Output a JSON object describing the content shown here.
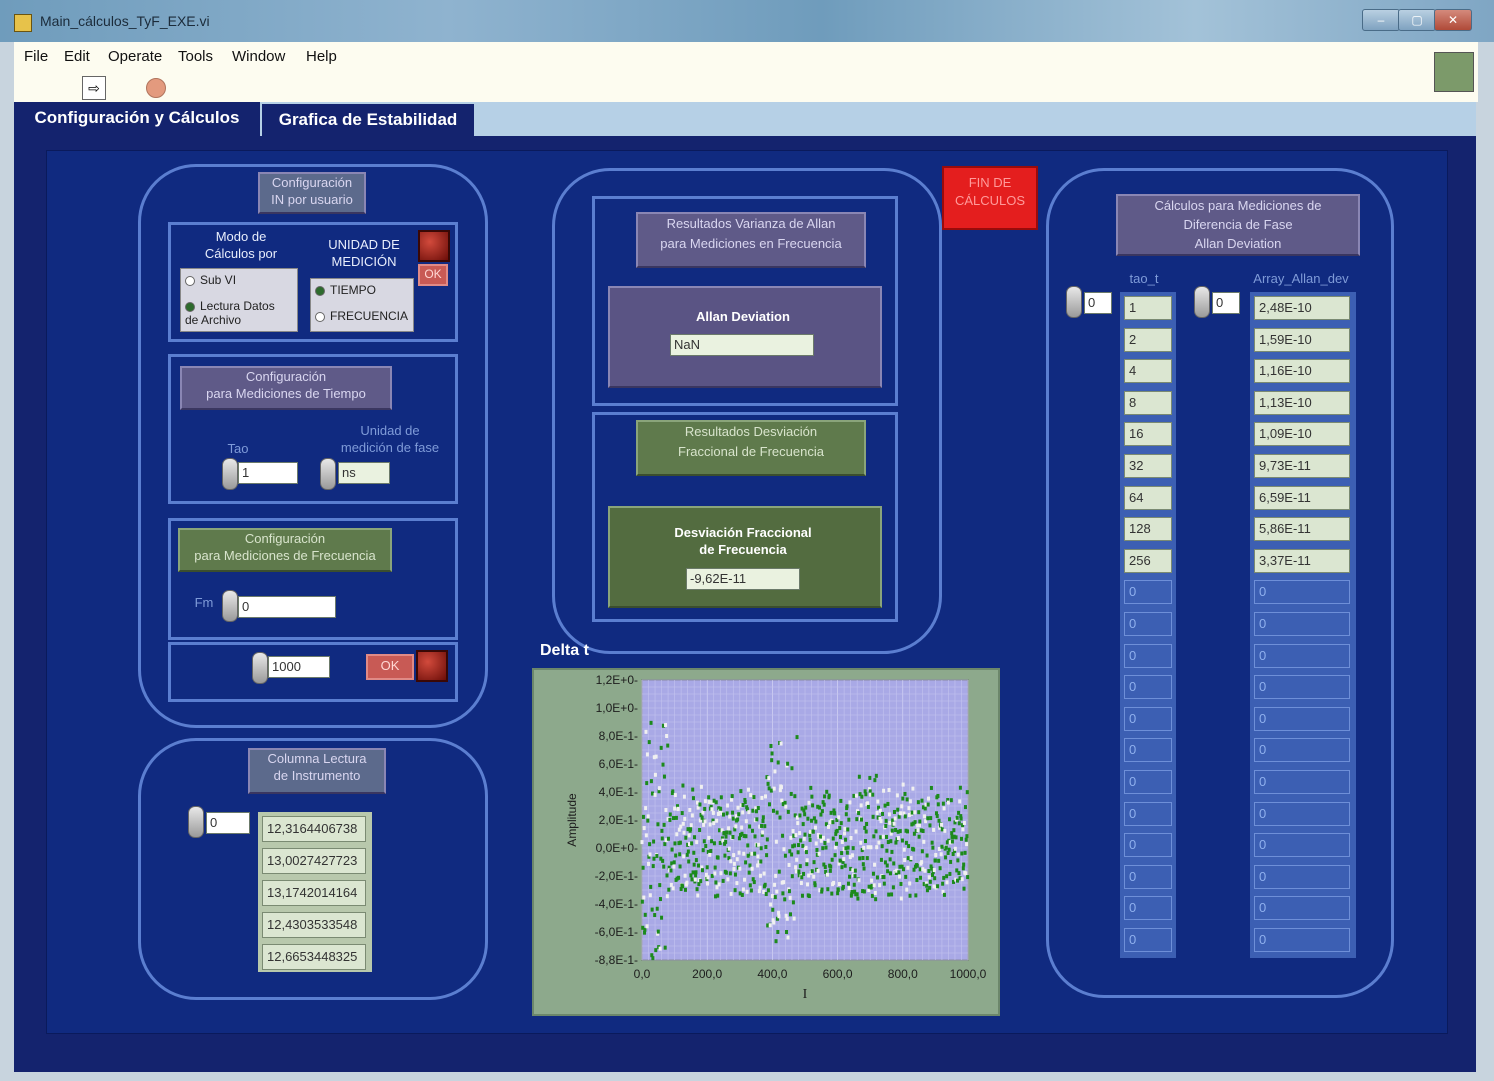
{
  "window": {
    "title": "Main_cálculos_TyF_EXE.vi",
    "min": "–",
    "max": "▢",
    "close": "✕"
  },
  "menu": [
    "File",
    "Edit",
    "Operate",
    "Tools",
    "Window",
    "Help"
  ],
  "tabs": [
    "Configuración y Cálculos",
    "Grafica de Estabilidad"
  ],
  "config": {
    "header": "Configuración\nIN por usuario",
    "modo_label": "Modo de\nCálculos por",
    "modo_options": [
      "Sub VI",
      "Lectura Datos\nde Archivo"
    ],
    "modo_selected": 1,
    "unidad_label": "UNIDAD DE\nMEDICIÓN",
    "unidad_options": [
      "TIEMPO",
      "FRECUENCIA"
    ],
    "unidad_selected": 0,
    "ok": "OK"
  },
  "tiempo": {
    "header": "Configuración\npara Mediciones de Tiempo",
    "tao_label": "Tao",
    "tao_value": "1",
    "unidad_fase_label": "Unidad de\nmedición de fase",
    "unidad_fase_value": "ns"
  },
  "frecuencia": {
    "header": "Configuración\npara Mediciones de Frecuencia",
    "fm_label": "Fm",
    "fm_value": "0"
  },
  "run": {
    "value": "1000",
    "ok": "OK"
  },
  "columna": {
    "header": "Columna Lectura\nde Instrumento",
    "index": "0",
    "values": [
      "12,3164406738",
      "13,0027427723",
      "13,1742014164",
      "12,4303533548",
      "12,6653448325"
    ]
  },
  "allan": {
    "header": "Resultados Varianza de Allan\npara Mediciones en Frecuencia",
    "label": "Allan Deviation",
    "value": "NaN"
  },
  "fraccional": {
    "header": "Resultados Desviación\nFraccional de Frecuencia",
    "label": "Desviación Fraccional\nde Frecuencia",
    "value": "-9,62E-11"
  },
  "fin": {
    "label": "FIN DE\nCÁLCULOS",
    "color": "#e41e1e"
  },
  "fase": {
    "header": "Cálculos para Mediciones de\nDiferencia de Fase\nAllan Deviation",
    "tao_label": "tao_t",
    "tao_index": "0",
    "tao_values": [
      "1",
      "2",
      "4",
      "8",
      "16",
      "32",
      "64",
      "128",
      "256",
      "0",
      "0",
      "0",
      "0",
      "0",
      "0",
      "0",
      "0",
      "0",
      "0",
      "0",
      "0"
    ],
    "dev_label": "Array_Allan_dev",
    "dev_index": "0",
    "dev_values": [
      "2,48E-10",
      "1,59E-10",
      "1,16E-10",
      "1,13E-10",
      "1,09E-10",
      "9,73E-11",
      "6,59E-11",
      "5,86E-11",
      "3,37E-11",
      "0",
      "0",
      "0",
      "0",
      "0",
      "0",
      "0",
      "0",
      "0",
      "0",
      "0",
      "0"
    ]
  },
  "chart_data": {
    "type": "scatter",
    "title": "Delta t",
    "xlabel": "I",
    "ylabel": "Amplitude",
    "xlim": [
      0,
      1000
    ],
    "ylim": [
      -0.88,
      1.2
    ],
    "x_ticks": [
      "0,0",
      "200,0",
      "400,0",
      "600,0",
      "800,0",
      "1000,0"
    ],
    "y_ticks": [
      "1,2E+0",
      "1,0E+0",
      "8,0E-1",
      "6,0E-1",
      "4,0E-1",
      "2,0E-1",
      "0,0E+0",
      "-2,0E-1",
      "-4,0E-1",
      "-6,0E-1",
      "-8,8E-1"
    ],
    "series_colors": [
      "#1c8a1c",
      "#f0f0f0"
    ],
    "grid": true
  }
}
